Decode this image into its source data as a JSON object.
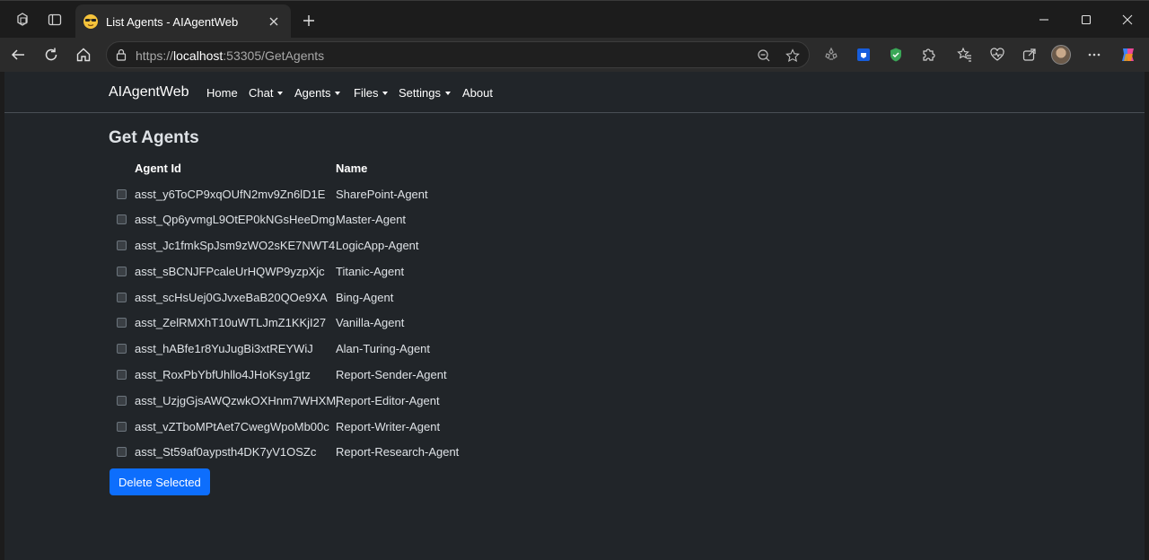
{
  "browser": {
    "tab_title": "List Agents - AIAgentWeb",
    "url_scheme": "https://",
    "url_host": "localhost",
    "url_rest": ":53305/GetAgents"
  },
  "navbar": {
    "brand": "AIAgentWeb",
    "items": [
      {
        "label": "Home",
        "dropdown": false
      },
      {
        "label": "Chat",
        "dropdown": true
      },
      {
        "label": "Agents",
        "dropdown": true
      },
      {
        "label": "Files",
        "dropdown": true
      },
      {
        "label": "Settings",
        "dropdown": true
      },
      {
        "label": "About",
        "dropdown": false
      }
    ]
  },
  "main": {
    "heading": "Get Agents",
    "columns": {
      "id": "Agent Id",
      "name": "Name"
    },
    "rows": [
      {
        "id": "asst_y6ToCP9xqOUfN2mv9Zn6lD1E",
        "name": "SharePoint-Agent"
      },
      {
        "id": "asst_Qp6yvmgL9OtEP0kNGsHeeDmg",
        "name": "Master-Agent"
      },
      {
        "id": "asst_Jc1fmkSpJsm9zWO2sKE7NWT4",
        "name": "LogicApp-Agent"
      },
      {
        "id": "asst_sBCNJFPcaleUrHQWP9yzpXjc",
        "name": "Titanic-Agent"
      },
      {
        "id": "asst_scHsUej0GJvxeBaB20QOe9XA",
        "name": "Bing-Agent"
      },
      {
        "id": "asst_ZelRMXhT10uWTLJmZ1KKjI27",
        "name": "Vanilla-Agent"
      },
      {
        "id": "asst_hABfe1r8YuJugBi3xtREYWiJ",
        "name": "Alan-Turing-Agent"
      },
      {
        "id": "asst_RoxPbYbfUhllo4JHoKsy1gtz",
        "name": "Report-Sender-Agent"
      },
      {
        "id": "asst_UzjgGjsAWQzwkOXHnm7WHXMj",
        "name": "Report-Editor-Agent"
      },
      {
        "id": "asst_vZTboMPtAet7CwegWpoMb00c",
        "name": "Report-Writer-Agent"
      },
      {
        "id": "asst_St59af0aypsth4DK7yV1OSZc",
        "name": "Report-Research-Agent"
      }
    ],
    "delete_button": "Delete Selected"
  },
  "colors": {
    "page_bg": "#212529",
    "primary_button": "#0d6efd",
    "browser_chrome": "#2b2b2b"
  }
}
